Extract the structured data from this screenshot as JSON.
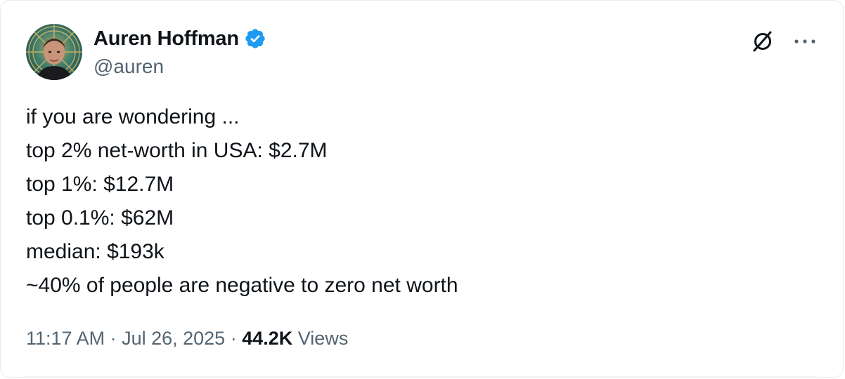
{
  "author": {
    "display_name": "Auren Hoffman",
    "handle": "@auren",
    "verified": true,
    "verified_color": "#1d9bf0"
  },
  "tweet": {
    "lines": [
      "if you are wondering ...",
      "top 2% net-worth in USA: $2.7M",
      "top 1%: $12.7M",
      "top 0.1%: $62M",
      "median: $193k",
      "~40% of people are negative to zero net worth"
    ]
  },
  "meta": {
    "time": "11:17 AM",
    "separator": " · ",
    "date": "Jul 26, 2025",
    "views_count": "44.2K",
    "views_label": "Views"
  },
  "icons": {
    "avatar": "profile-photo",
    "verified": "verified-badge-icon",
    "grok": "grok-icon",
    "more": "more-dots-icon"
  },
  "colors": {
    "text_primary": "#0f1419",
    "text_secondary": "#536471",
    "accent": "#1d9bf0",
    "border": "#e8ecef"
  }
}
